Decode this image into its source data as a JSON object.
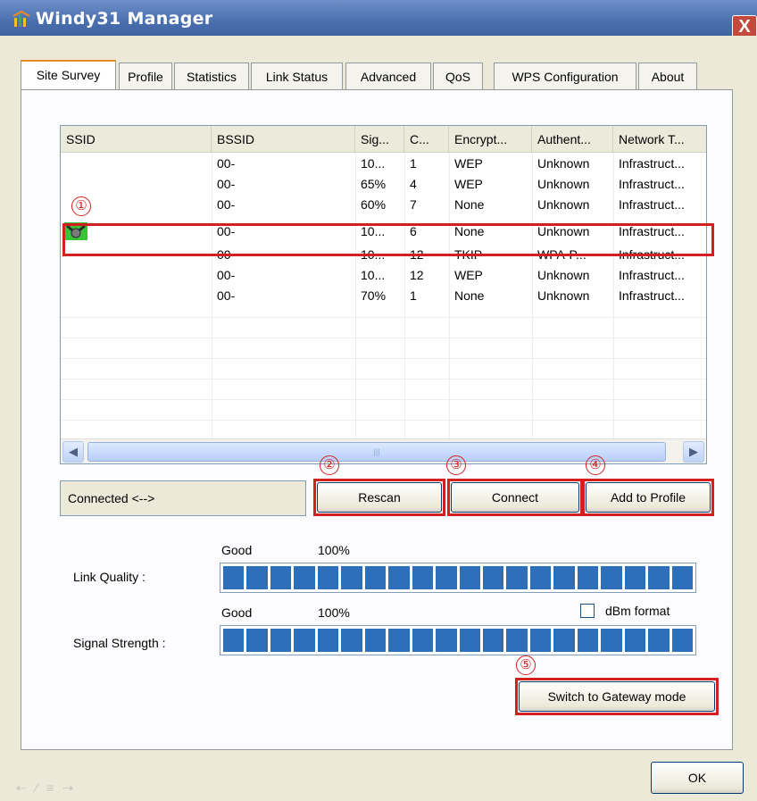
{
  "window": {
    "title": "Windy31 Manager",
    "close_label": "X"
  },
  "tabs": [
    "Site Survey",
    "Profile",
    "Statistics",
    "Link Status",
    "Advanced",
    "QoS",
    "WPS Configuration",
    "About"
  ],
  "active_tab": "Site Survey",
  "list": {
    "columns": [
      "SSID",
      "BSSID",
      "Sig...",
      "C...",
      "Encrypt...",
      "Authent...",
      "Network T..."
    ],
    "rows": [
      {
        "ssid": "",
        "bssid": "00-",
        "signal": "10...",
        "channel": "1",
        "encryption": "WEP",
        "auth": "Unknown",
        "network": "Infrastruct..."
      },
      {
        "ssid": "",
        "bssid": "00-",
        "signal": "65%",
        "channel": "4",
        "encryption": "WEP",
        "auth": "Unknown",
        "network": "Infrastruct..."
      },
      {
        "ssid": "",
        "bssid": "00-",
        "signal": "60%",
        "channel": "7",
        "encryption": "None",
        "auth": "Unknown",
        "network": "Infrastruct..."
      },
      {
        "ssid": "",
        "bssid": "00-",
        "signal": "10...",
        "channel": "6",
        "encryption": "None",
        "auth": "Unknown",
        "network": "Infrastruct...",
        "connected": true
      },
      {
        "ssid": "",
        "bssid": "00-",
        "signal": "10...",
        "channel": "12",
        "encryption": "TKIP",
        "auth": "WPA-P...",
        "network": "Infrastruct..."
      },
      {
        "ssid": "",
        "bssid": "00-",
        "signal": "10...",
        "channel": "12",
        "encryption": "WEP",
        "auth": "Unknown",
        "network": "Infrastruct..."
      },
      {
        "ssid": "",
        "bssid": "00-",
        "signal": "70%",
        "channel": "1",
        "encryption": "None",
        "auth": "Unknown",
        "network": "Infrastruct..."
      }
    ],
    "connected_icon": "connected-network-icon"
  },
  "status": {
    "text": "Connected <-->"
  },
  "buttons": {
    "rescan": "Rescan",
    "connect": "Connect",
    "add_to_profile": "Add to Profile",
    "gateway": "Switch to Gateway mode",
    "ok": "OK"
  },
  "markers": [
    "①",
    "②",
    "③",
    "④",
    "⑤"
  ],
  "link_quality": {
    "label": "Link Quality :",
    "rating": "Good",
    "percent": "100%",
    "level": 1.0
  },
  "signal_strength": {
    "label": "Signal Strength :",
    "rating": "Good",
    "percent": "100%",
    "level": 1.0
  },
  "dbm": {
    "label": "dBm format",
    "checked": false
  },
  "colors": {
    "titlebar": "#4a6fae",
    "highlight": "#d41f1f",
    "meter": "#2d6fb8"
  }
}
